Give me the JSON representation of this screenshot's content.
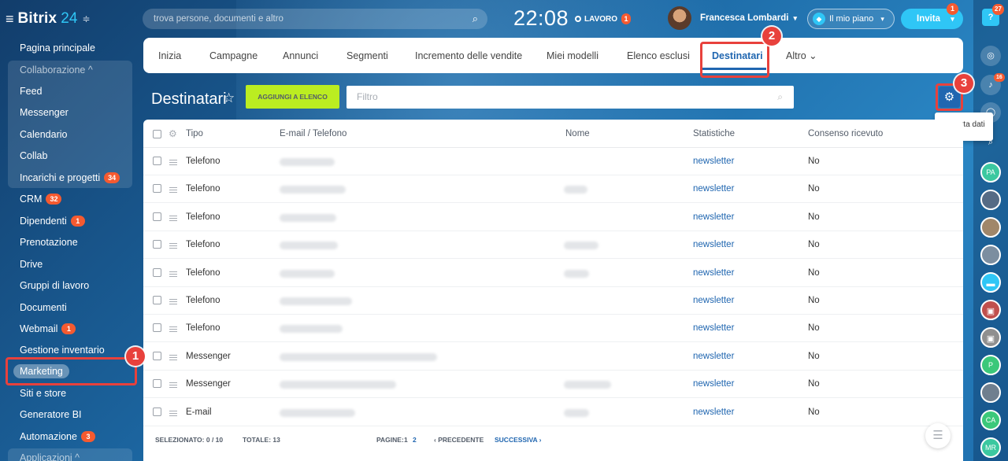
{
  "app": {
    "name": "Bitrix",
    "version": "24"
  },
  "header": {
    "search_placeholder": "trova persone, documenti e altro",
    "clock": "22:08",
    "work_status": "LAVORO",
    "work_badge": "1",
    "user_name": "Francesca Lombardi",
    "plan_label": "Il mio piano",
    "invite_label": "Invita",
    "invite_badge": "1"
  },
  "sidebar": {
    "items": [
      {
        "label": "Pagina principale"
      },
      {
        "label": "Collaborazione ^"
      },
      {
        "label": "Feed"
      },
      {
        "label": "Messenger"
      },
      {
        "label": "Calendario"
      },
      {
        "label": "Collab"
      },
      {
        "label": "Incarichi e progetti",
        "badge": "34"
      },
      {
        "label": "CRM",
        "badge": "32"
      },
      {
        "label": "Dipendenti",
        "badge": "1"
      },
      {
        "label": "Prenotazione"
      },
      {
        "label": "Drive"
      },
      {
        "label": "Gruppi di lavoro"
      },
      {
        "label": "Documenti"
      },
      {
        "label": "Webmail",
        "badge": "1"
      },
      {
        "label": "Gestione inventario"
      },
      {
        "label": "Marketing"
      },
      {
        "label": "Siti e store"
      },
      {
        "label": "Generatore BI"
      },
      {
        "label": "Automazione",
        "badge": "3"
      },
      {
        "label": "Applicazioni ^"
      }
    ]
  },
  "tabs": [
    "Inizia",
    "Campagne",
    "Annunci",
    "Segmenti",
    "Incremento delle vendite",
    "Miei modelli",
    "Elenco esclusi",
    "Destinatari",
    "Altro ⌄"
  ],
  "page": {
    "title": "Destinatari",
    "add_button": "AGGIUNGI A ELENCO",
    "filter_placeholder": "Filtro",
    "export_label": "Esporta dati"
  },
  "table": {
    "columns": [
      "Tipo",
      "E-mail / Telefono",
      "Nome",
      "Statistiche",
      "Consenso ricevuto"
    ],
    "rows": [
      {
        "type": "Telefono",
        "stats": "newsletter",
        "consent": "No"
      },
      {
        "type": "Telefono",
        "stats": "newsletter",
        "consent": "No"
      },
      {
        "type": "Telefono",
        "stats": "newsletter",
        "consent": "No"
      },
      {
        "type": "Telefono",
        "stats": "newsletter",
        "consent": "No"
      },
      {
        "type": "Telefono",
        "stats": "newsletter",
        "consent": "No"
      },
      {
        "type": "Telefono",
        "stats": "newsletter",
        "consent": "No"
      },
      {
        "type": "Telefono",
        "stats": "newsletter",
        "consent": "No"
      },
      {
        "type": "Messenger",
        "stats": "newsletter",
        "consent": "No"
      },
      {
        "type": "Messenger",
        "stats": "newsletter",
        "consent": "No"
      },
      {
        "type": "E-mail",
        "stats": "newsletter",
        "consent": "No"
      }
    ]
  },
  "footer": {
    "selected": "SELEZIONATO: 0 / 10",
    "total": "TOTALE: 13",
    "pages_label": "PAGINE:",
    "page_1": "1",
    "page_2": "2",
    "prev": "‹ PRECEDENTE",
    "next": "SUCCESSIVA ›"
  },
  "right_rail": {
    "top_badge": "27",
    "bell_badge": "16",
    "avatars": [
      "PA",
      "P",
      "CA",
      "MR"
    ]
  },
  "annotations": [
    "1",
    "2",
    "3"
  ],
  "colors": {
    "accent": "#2066b0",
    "add_button": "#bbed21",
    "badge": "#f55a30",
    "highlight": "#e8413c"
  }
}
